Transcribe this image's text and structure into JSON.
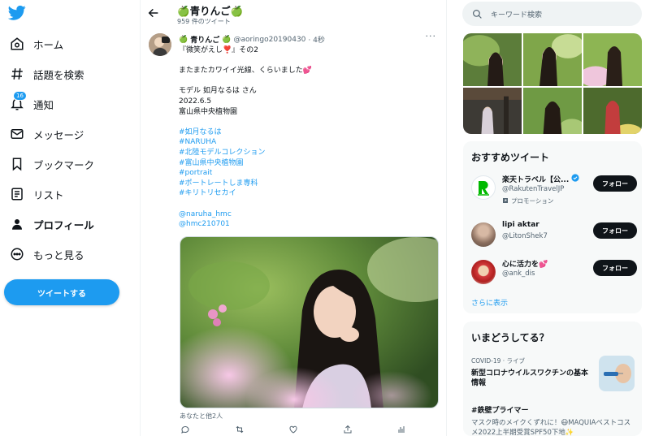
{
  "colors": {
    "accent": "#1d9bf0",
    "text": "#0f1419",
    "secondary": "#536471"
  },
  "nav": {
    "logo": "twitter-bird-icon",
    "items": [
      {
        "label": "ホーム",
        "icon": "home-icon"
      },
      {
        "label": "話題を検索",
        "icon": "hashtag-icon"
      },
      {
        "label": "通知",
        "icon": "bell-icon",
        "badge": "16"
      },
      {
        "label": "メッセージ",
        "icon": "envelope-icon"
      },
      {
        "label": "ブックマーク",
        "icon": "bookmark-icon"
      },
      {
        "label": "リスト",
        "icon": "list-icon"
      },
      {
        "label": "プロフィール",
        "icon": "person-icon"
      },
      {
        "label": "もっと見る",
        "icon": "more-circle-icon"
      }
    ],
    "tweet_button": "ツイートする"
  },
  "header": {
    "title": "青りんご",
    "tweet_count": "959 件のツイート"
  },
  "tweet": {
    "name": "青りんご",
    "handle": "@aoringo20190430",
    "time": "· 4秒",
    "lines": [
      "『微笑がえし❣️』その2",
      "",
      "またまたカワイイ光線、くらいました💕",
      "",
      "モデル 如月なるは さん",
      "2022.6.5",
      "富山県中央植物園",
      ""
    ],
    "hashtags": [
      "#如月なるは",
      "#NARUHA",
      "#北陸モデルコレクション",
      "#富山県中央植物園",
      "#portrait",
      "#ポートレートしま専科",
      "#キリトリセカイ"
    ],
    "mentions": [
      "@naruha_hmc",
      "@hmc210701"
    ],
    "liked_by": "あなたと他2人"
  },
  "sidebar": {
    "search_placeholder": "キーワード検索",
    "recommend_title": "おすすめツイート",
    "recommendations": [
      {
        "name": "楽天トラベル【公...",
        "handle": "@RakutenTravelJP",
        "promo": "プロモーション",
        "verified": true,
        "button": "フォロー"
      },
      {
        "name": "lipi aktar",
        "handle": "@LitonShek7",
        "button": "フォロー"
      },
      {
        "name": "心に活力を💕",
        "handle": "@ank_dis",
        "button": "フォロー"
      }
    ],
    "show_more": "さらに表示",
    "trends_title": "いまどうしてる？",
    "trends": [
      {
        "category": "COVID-19 · ライブ",
        "title": "新型コロナウイルスワクチンの基本情報"
      },
      {
        "category": "",
        "title": "#鉄壁プライマー",
        "desc": "マスク時のメイクくずれに！😷MAQUIAベストコスメ2022上半期受賞SPF50下地✨"
      }
    ]
  }
}
